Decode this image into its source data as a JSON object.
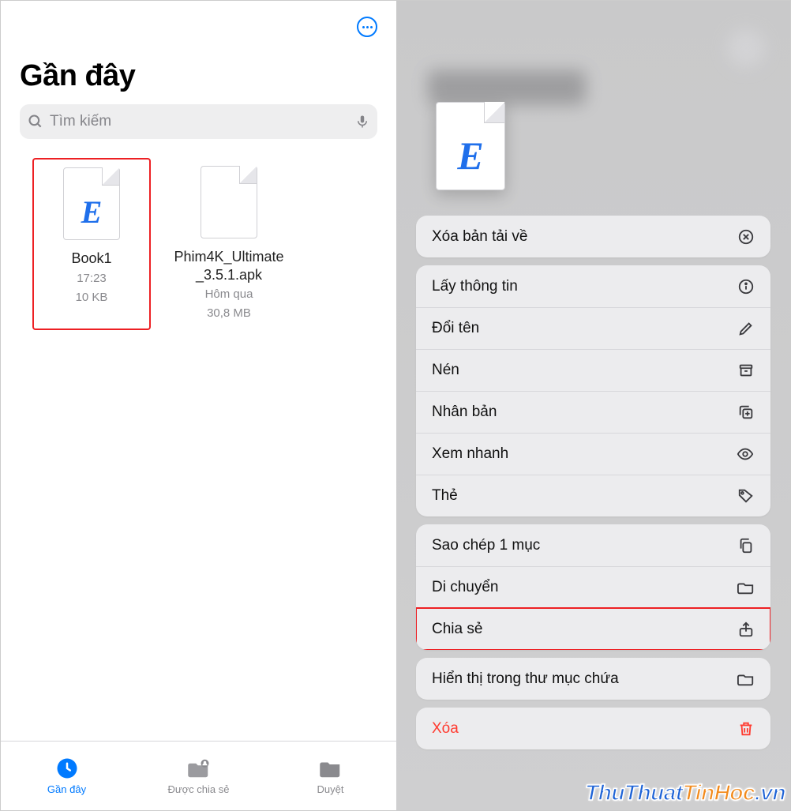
{
  "header": {
    "title": "Gần đây"
  },
  "search": {
    "placeholder": "Tìm kiếm"
  },
  "files": [
    {
      "name": "Book1",
      "time": "17:23",
      "size": "10 KB",
      "icon": "excel",
      "highlighted": true
    },
    {
      "name": "Phim4K_Ultimate_3.5.1.apk",
      "time": "Hôm qua",
      "size": "30,8 MB",
      "icon": "blank",
      "highlighted": false
    }
  ],
  "tabs": {
    "recent": "Gần đây",
    "shared": "Được chia sẻ",
    "browse": "Duyệt"
  },
  "context_menu": {
    "groups": [
      [
        {
          "key": "remove_download",
          "label": "Xóa bản tải về",
          "icon": "circle-x"
        }
      ],
      [
        {
          "key": "get_info",
          "label": "Lấy thông tin",
          "icon": "info"
        },
        {
          "key": "rename",
          "label": "Đổi tên",
          "icon": "pencil"
        },
        {
          "key": "compress",
          "label": "Nén",
          "icon": "archive"
        },
        {
          "key": "duplicate",
          "label": "Nhân bản",
          "icon": "copy-plus"
        },
        {
          "key": "quick_look",
          "label": "Xem nhanh",
          "icon": "eye"
        },
        {
          "key": "tags",
          "label": "Thẻ",
          "icon": "tag"
        }
      ],
      [
        {
          "key": "copy",
          "label": "Sao chép 1 mục",
          "icon": "copy"
        },
        {
          "key": "move",
          "label": "Di chuyển",
          "icon": "folder"
        },
        {
          "key": "share",
          "label": "Chia sẻ",
          "icon": "share",
          "highlighted": true
        }
      ],
      [
        {
          "key": "show_folder",
          "label": "Hiển thị trong thư mục chứa",
          "icon": "folder"
        }
      ],
      [
        {
          "key": "delete",
          "label": "Xóa",
          "icon": "trash",
          "danger": true
        }
      ]
    ]
  },
  "watermark": "ThuThuatTinHoc.vn"
}
